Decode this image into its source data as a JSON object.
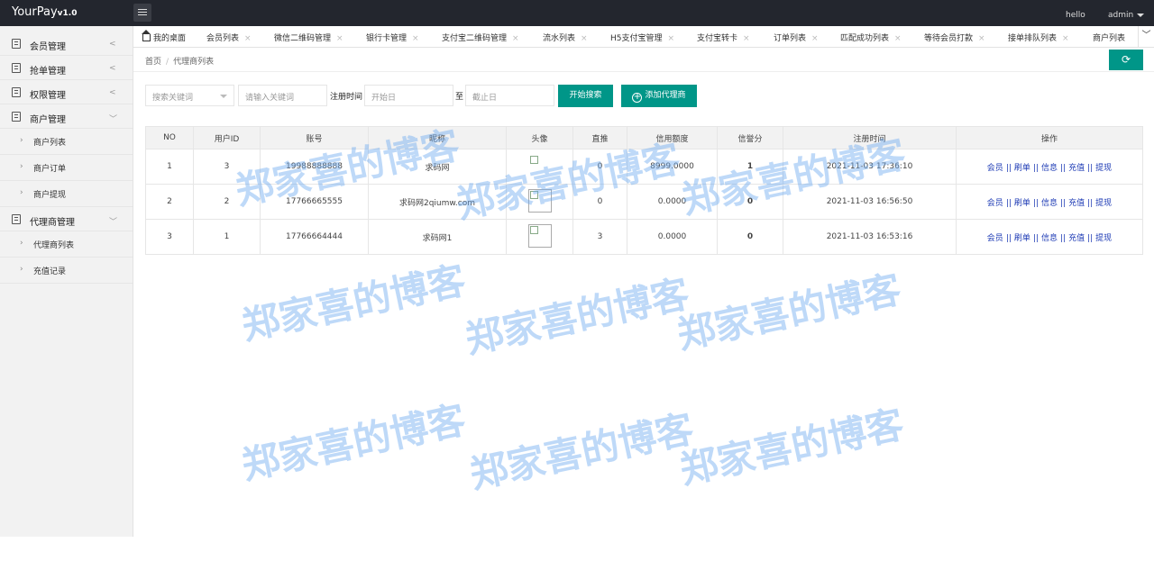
{
  "topbar": {
    "logo": "YourPay",
    "version": "v1.0",
    "hello": "hello",
    "user": "admin"
  },
  "sidebar": {
    "items": [
      {
        "label": "会员管理",
        "expanded": false
      },
      {
        "label": "抢单管理",
        "expanded": false
      },
      {
        "label": "权限管理",
        "expanded": false
      },
      {
        "label": "商户管理",
        "expanded": true,
        "children": [
          "商户列表",
          "商户订单",
          "商户提现"
        ]
      },
      {
        "label": "代理商管理",
        "expanded": true,
        "children": [
          "代理商列表",
          "充值记录"
        ]
      }
    ]
  },
  "tabs": [
    "我的桌面",
    "会员列表",
    "微信二维码管理",
    "银行卡管理",
    "支付宝二维码管理",
    "流水列表",
    "H5支付宝管理",
    "支付宝转卡",
    "订单列表",
    "匹配成功列表",
    "等待会员打款",
    "接单排队列表",
    "商户列表"
  ],
  "tab_close": "×",
  "breadcrumb": {
    "home": "首页",
    "sep": "/",
    "current": "代理商列表"
  },
  "search": {
    "keyword_select": "搜索关键词",
    "keyword_placeholder": "请输入关键词",
    "reg_time_label": "注册时间",
    "start_placeholder": "开始日",
    "to_label": "至",
    "end_placeholder": "截止日",
    "search_button": "开始搜索",
    "add_button": "添加代理商"
  },
  "table": {
    "columns": [
      "NO",
      "用户ID",
      "账号",
      "昵称",
      "头像",
      "直推",
      "信用额度",
      "信誉分",
      "注册时间",
      "操作"
    ],
    "rows": [
      {
        "no": "1",
        "uid": "3",
        "account": "19988888888",
        "nickname": "求码网",
        "direct": "0",
        "credit_limit": "8999.0000",
        "score": "1",
        "reg_time": "2021-11-03 17:36:10"
      },
      {
        "no": "2",
        "uid": "2",
        "account": "17766665555",
        "nickname": "求码网2qiumw.com",
        "direct": "0",
        "credit_limit": "0.0000",
        "score": "0",
        "reg_time": "2021-11-03 16:56:50"
      },
      {
        "no": "3",
        "uid": "1",
        "account": "17766664444",
        "nickname": "求码网1",
        "direct": "3",
        "credit_limit": "0.0000",
        "score": "0",
        "reg_time": "2021-11-03 16:53:16"
      }
    ],
    "ops": [
      "会员",
      "刷单",
      "信息",
      "充值",
      "提现"
    ],
    "ops_sep": "||"
  },
  "watermark": "郑家喜的博客",
  "colors": {
    "topbar": "#23262e",
    "primary": "#009688",
    "link": "#1e3bb5",
    "danger": "#e00000"
  }
}
